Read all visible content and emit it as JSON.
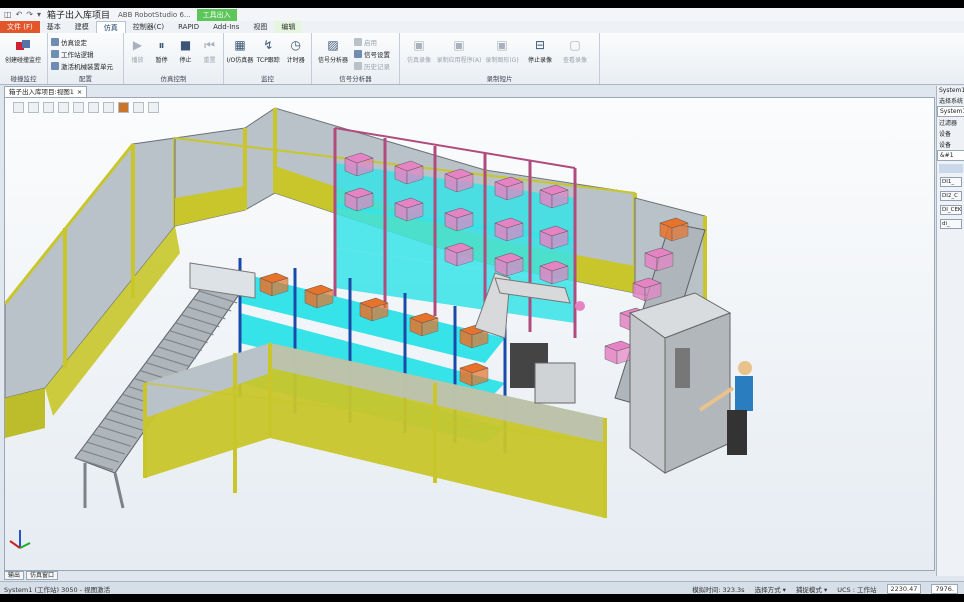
{
  "window": {
    "title": "箱子出入库项目",
    "app_name": "ABB RobotStudio 6...",
    "context_tab": "工具出入",
    "quick_access": [
      "save-icon",
      "undo-icon",
      "redo-icon",
      "dropdown-icon"
    ]
  },
  "menu_tabs": [
    {
      "label": "文件 (F)",
      "kind": "file"
    },
    {
      "label": "基本",
      "kind": ""
    },
    {
      "label": "建模",
      "kind": ""
    },
    {
      "label": "仿真",
      "kind": "active"
    },
    {
      "label": "控制器(C)",
      "kind": ""
    },
    {
      "label": "RAPID",
      "kind": ""
    },
    {
      "label": "Add-Ins",
      "kind": ""
    },
    {
      "label": "视图",
      "kind": ""
    },
    {
      "label": "编辑",
      "kind": "ctx"
    }
  ],
  "ribbon": {
    "g1": {
      "label": "碰撞监控",
      "big": "创建碰撞监控"
    },
    "g2": {
      "label": "配置",
      "small": [
        "仿真设定",
        "工作站逻辑",
        "激活机械装置单元"
      ]
    },
    "g3": {
      "label": "仿真控制",
      "buttons": [
        "播放",
        "暂停",
        "停止",
        "重置"
      ]
    },
    "g4": {
      "label": "监控",
      "buttons": [
        "I/O仿真器",
        "TCP跟踪",
        "计时器"
      ]
    },
    "g5": {
      "label": "信号分析器",
      "big": "信号分析器",
      "small": [
        "启用",
        "信号设置",
        "历史记录"
      ]
    },
    "g6": {
      "label": "录制短片",
      "buttons": [
        "仿真录像",
        "录制应用程序(A)",
        "录制图形(G)",
        "停止录像",
        "查看录像"
      ]
    }
  },
  "document_tab": {
    "label": "箱子出入库项目:视图1",
    "close": "×"
  },
  "right_panel": {
    "lines": [
      "System1",
      "选择系统",
      "System1",
      "过滤器",
      "设备",
      "设备",
      "&#1"
    ],
    "buttons": [
      "DI1_",
      "DI2_C",
      "DI_CEK",
      "di_"
    ]
  },
  "output_tabs": [
    "输出",
    "仿真窗口"
  ],
  "status": {
    "left": "System1 (工作站) 3050 - 视图激活",
    "sim_time": "模拟时间: 323.3s",
    "select_mode": "选择方式 ▾",
    "snap_mode": "捕捉模式 ▾",
    "ucs": "UCS : 工作站",
    "x": "2230.47",
    "y": "7976."
  },
  "colors": {
    "fence_post": "#c8c62a",
    "fence_panel": "#b9c2c8",
    "conveyor": "#aeb5bb",
    "shelf_top": "#36e3e8",
    "rack_frame": "#1a4aa8",
    "box_orange": "#e8722a",
    "box_pink": "#e583c5",
    "rack_pink": "#b04b7e"
  }
}
